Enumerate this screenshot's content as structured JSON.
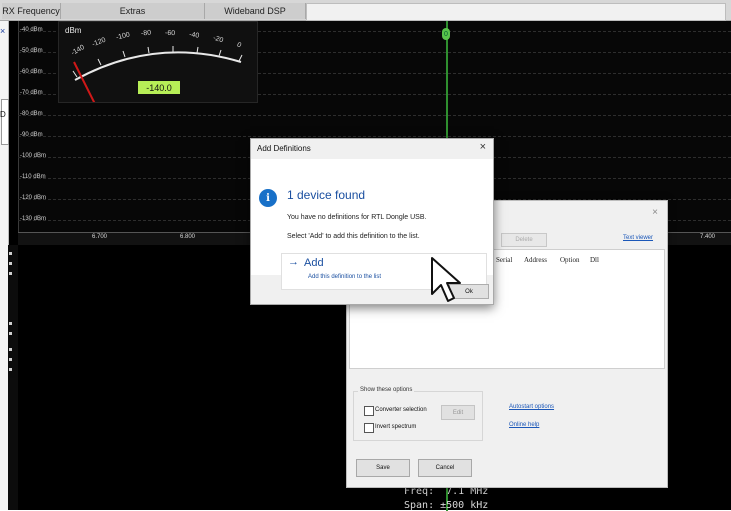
{
  "tabs": [
    "RX Frequency",
    "Extras",
    "Wideband DSP"
  ],
  "spectrum": {
    "dbm_levels": [
      "-40 dBm",
      "-50 dBm",
      "-60 dBm",
      "-70 dBm",
      "-80 dBm",
      "-90 dBm",
      "-100 dBm",
      "-110 dBm",
      "-120 dBm",
      "-130 dBm"
    ],
    "frequency_ticks": [
      "6.700",
      "6.800",
      "7.400"
    ],
    "marker_label": "0"
  },
  "smeter": {
    "unit": "dBm",
    "scale": [
      "-140",
      "-120",
      "-100",
      "-80",
      "-60",
      "-40",
      "-20",
      "0"
    ],
    "value": "-140.0"
  },
  "readout": {
    "freq": "Freq:  7.1 MHz",
    "span": "Span: ±500 kHz"
  },
  "left_strip": {
    "close_glyph": "×",
    "letter": "D"
  },
  "settings_dialog": {
    "close_glyph": "×",
    "delete_label": "Delete",
    "text_viewer_label": "Text viewer",
    "columns": [
      "Serial",
      "Address",
      "Option",
      "Dll"
    ],
    "options_title": "Show these options",
    "converter_label": "Converter selection",
    "edit_label": "Edit",
    "invert_label": "Invert spectrum",
    "autostart_label": "Autostart options",
    "online_help_label": "Online help",
    "save_label": "Save",
    "cancel_label": "Cancel"
  },
  "add_definitions": {
    "title": "Add Definitions",
    "close_glyph": "×",
    "info_glyph": "i",
    "heading": "1 device found",
    "message": "You have no definitions for RTL Dongle USB.",
    "instruction": "Select 'Add' to add this definition to the list.",
    "add_arrow": "→",
    "add_title": "Add",
    "add_subtitle": "Add this definition to the list",
    "button_label": "Ok"
  },
  "colors": {
    "meter_value_bg": "#b7ee57",
    "marker_green": "#2f8f2f",
    "needle": "#d01818",
    "link_blue": "#1b57b8",
    "heading_blue": "#1a4fa0"
  },
  "icons": {
    "info": "info-icon",
    "close": "close-icon",
    "cursor": "mouse-cursor-icon"
  }
}
